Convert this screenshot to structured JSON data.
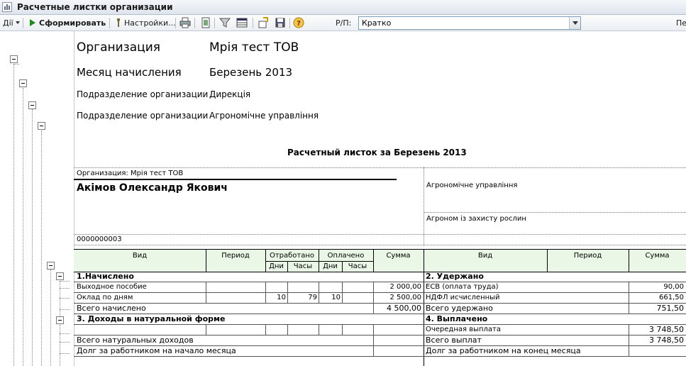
{
  "window": {
    "title": "Расчетные листки организации"
  },
  "toolbar": {
    "actions_label": "Дії",
    "form_label": "Сформировать",
    "settings_label": "Настройки...",
    "rp_label": "Р/П:",
    "rp_value": "Кратко",
    "right_label": "Пе"
  },
  "header": {
    "org_label": "Организация",
    "org_value": "Мрія тест ТОВ",
    "month_label": "Месяц начисления",
    "month_value": "Березень 2013",
    "dept1_label": "Подразделение организации",
    "dept1_value": "Дирекція",
    "dept2_label": "Подразделение организации",
    "dept2_value": "Агрономічне управління"
  },
  "report": {
    "title": "Расчетный листок за Березень 2013",
    "org_line": "Организация: Мрія тест ТОВ",
    "employee": "Акімов Олександр Якович",
    "department": "Агрономічне управління",
    "position": "Агроном із захисту рослин",
    "tab_number": "0000000003"
  },
  "table": {
    "headers": {
      "vid": "Вид",
      "period": "Период",
      "worked": "Отработано",
      "paid": "Оплачено",
      "sum": "Сумма",
      "vid2": "Вид",
      "period2": "Период",
      "sum2": "Сумма",
      "days": "Дни",
      "hours": "Часы",
      "days2": "Дни",
      "hours2": "Часы"
    },
    "sec1": "1.Начислено",
    "sec2": "2. Удержано",
    "sec3": "3. Доходы в натуральной форме",
    "sec4": "4. Выплачено",
    "left_rows": [
      {
        "name": "Выходное пособие",
        "days": "",
        "hours": "",
        "pdays": "",
        "sum": "2 000,00"
      },
      {
        "name": "Оклад по дням",
        "days": "10",
        "hours": "79",
        "pdays": "10",
        "sum": "2 500,00"
      }
    ],
    "right_rows": [
      {
        "name": "ЕСВ (оплата труда)",
        "sum": "90,00"
      },
      {
        "name": "НДФЛ исчисленный",
        "sum": "661,50"
      }
    ],
    "total_accrued_label": "Всего начислено",
    "total_accrued": "4 500,00",
    "total_withheld_label": "Всего удержано",
    "total_withheld": "751,50",
    "payout_row": {
      "name": "Очередная выплата",
      "sum": "3 748,50"
    },
    "total_natural_label": "Всего натуральных доходов",
    "total_paid_label": "Всего выплат",
    "total_paid": "3 748,50",
    "debt_start_label": "Долг за работником на начало месяца",
    "debt_end_label": "Долг за работником на конец месяца"
  }
}
